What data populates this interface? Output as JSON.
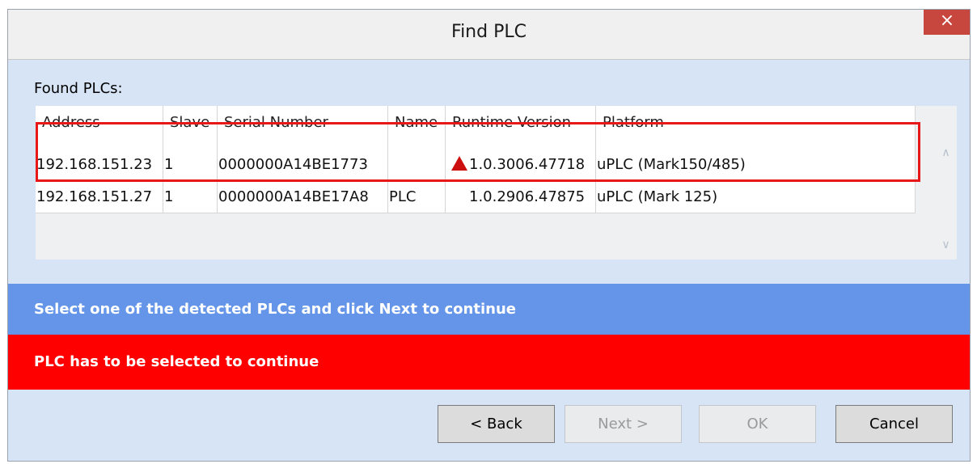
{
  "window": {
    "title": "Find PLC",
    "close_label": "×"
  },
  "found_label": "Found PLCs:",
  "table": {
    "columns": [
      "Address",
      "Slave",
      "Serial Number",
      "Name",
      "Runtime Version",
      "Platform"
    ],
    "rows": [
      {
        "address": "192.168.151.23",
        "slave": "1",
        "serial": "0000000A14BE1773",
        "name": "",
        "version": "1.0.3006.47718",
        "version_warning": true,
        "platform": "uPLC (Mark150/485)"
      },
      {
        "address": "192.168.151.27",
        "slave": "1",
        "serial": "0000000A14BE17A8",
        "name": "PLC",
        "version": "1.0.2906.47875",
        "version_warning": false,
        "platform": "uPLC (Mark 125)"
      }
    ]
  },
  "info_message": "Select one of the detected PLCs and click Next to continue",
  "error_message": "PLC has to be selected to continue",
  "buttons": {
    "back": "< Back",
    "next": "Next >",
    "ok": "OK",
    "cancel": "Cancel"
  },
  "colors": {
    "info_bar": "#6495e9",
    "error_bar": "#ff0000",
    "highlight": "#e81818",
    "close_button": "#c7463d"
  }
}
